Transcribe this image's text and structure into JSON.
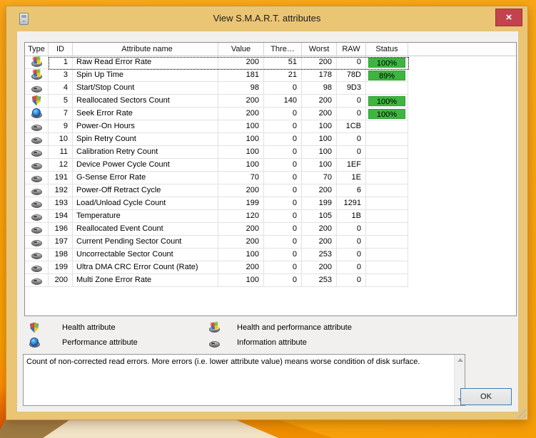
{
  "window": {
    "title": "View S.M.A.R.T. attributes",
    "close_glyph": "×"
  },
  "table": {
    "headers": {
      "type": "Type",
      "id": "ID",
      "name": "Attribute name",
      "value": "Value",
      "threshold": "Thre…",
      "worst": "Worst",
      "raw": "RAW",
      "status": "Status"
    },
    "rows": [
      {
        "icon": "hp",
        "id": "1",
        "name": "Raw Read Error Rate",
        "value": "200",
        "threshold": "51",
        "worst": "200",
        "raw": "0",
        "status": "100%",
        "selected": true
      },
      {
        "icon": "hp",
        "id": "3",
        "name": "Spin Up Time",
        "value": "181",
        "threshold": "21",
        "worst": "178",
        "raw": "78D",
        "status": "89%"
      },
      {
        "icon": "info",
        "id": "4",
        "name": "Start/Stop Count",
        "value": "98",
        "threshold": "0",
        "worst": "98",
        "raw": "9D3",
        "status": ""
      },
      {
        "icon": "health",
        "id": "5",
        "name": "Reallocated Sectors Count",
        "value": "200",
        "threshold": "140",
        "worst": "200",
        "raw": "0",
        "status": "100%"
      },
      {
        "icon": "perf",
        "id": "7",
        "name": "Seek Error Rate",
        "value": "200",
        "threshold": "0",
        "worst": "200",
        "raw": "0",
        "status": "100%"
      },
      {
        "icon": "info",
        "id": "9",
        "name": "Power-On Hours",
        "value": "100",
        "threshold": "0",
        "worst": "100",
        "raw": "1CB",
        "status": ""
      },
      {
        "icon": "info",
        "id": "10",
        "name": "Spin Retry Count",
        "value": "100",
        "threshold": "0",
        "worst": "100",
        "raw": "0",
        "status": ""
      },
      {
        "icon": "info",
        "id": "11",
        "name": "Calibration Retry Count",
        "value": "100",
        "threshold": "0",
        "worst": "100",
        "raw": "0",
        "status": ""
      },
      {
        "icon": "info",
        "id": "12",
        "name": "Device Power Cycle Count",
        "value": "100",
        "threshold": "0",
        "worst": "100",
        "raw": "1EF",
        "status": ""
      },
      {
        "icon": "info",
        "id": "191",
        "name": "G-Sense Error Rate",
        "value": "70",
        "threshold": "0",
        "worst": "70",
        "raw": "1E",
        "status": ""
      },
      {
        "icon": "info",
        "id": "192",
        "name": "Power-Off Retract Cycle",
        "value": "200",
        "threshold": "0",
        "worst": "200",
        "raw": "6",
        "status": ""
      },
      {
        "icon": "info",
        "id": "193",
        "name": "Load/Unload Cycle Count",
        "value": "199",
        "threshold": "0",
        "worst": "199",
        "raw": "1291",
        "status": ""
      },
      {
        "icon": "info",
        "id": "194",
        "name": "Temperature",
        "value": "120",
        "threshold": "0",
        "worst": "105",
        "raw": "1B",
        "status": ""
      },
      {
        "icon": "info",
        "id": "196",
        "name": "Reallocated Event Count",
        "value": "200",
        "threshold": "0",
        "worst": "200",
        "raw": "0",
        "status": ""
      },
      {
        "icon": "info",
        "id": "197",
        "name": "Current Pending Sector Count",
        "value": "200",
        "threshold": "0",
        "worst": "200",
        "raw": "0",
        "status": ""
      },
      {
        "icon": "info",
        "id": "198",
        "name": "Uncorrectable Sector Count",
        "value": "100",
        "threshold": "0",
        "worst": "253",
        "raw": "0",
        "status": ""
      },
      {
        "icon": "info",
        "id": "199",
        "name": "Ultra DMA CRC Error Count (Rate)",
        "value": "200",
        "threshold": "0",
        "worst": "200",
        "raw": "0",
        "status": ""
      },
      {
        "icon": "info",
        "id": "200",
        "name": "Multi Zone Error Rate",
        "value": "100",
        "threshold": "0",
        "worst": "253",
        "raw": "0",
        "status": ""
      }
    ]
  },
  "legend": {
    "items": [
      {
        "icon": "health",
        "label": "Health attribute"
      },
      {
        "icon": "hp",
        "label": "Health and performance attribute"
      },
      {
        "icon": "perf",
        "label": "Performance attribute"
      },
      {
        "icon": "info",
        "label": "Information attribute"
      }
    ]
  },
  "description": {
    "text": "Count of non-corrected read errors. More errors (i.e. lower attribute value) means worse condition of disk surface."
  },
  "buttons": {
    "ok": "OK"
  },
  "colors": {
    "status_ok_green": "#3FB53F",
    "titlebar_gold": "#EAC573",
    "close_red": "#C2424D"
  }
}
